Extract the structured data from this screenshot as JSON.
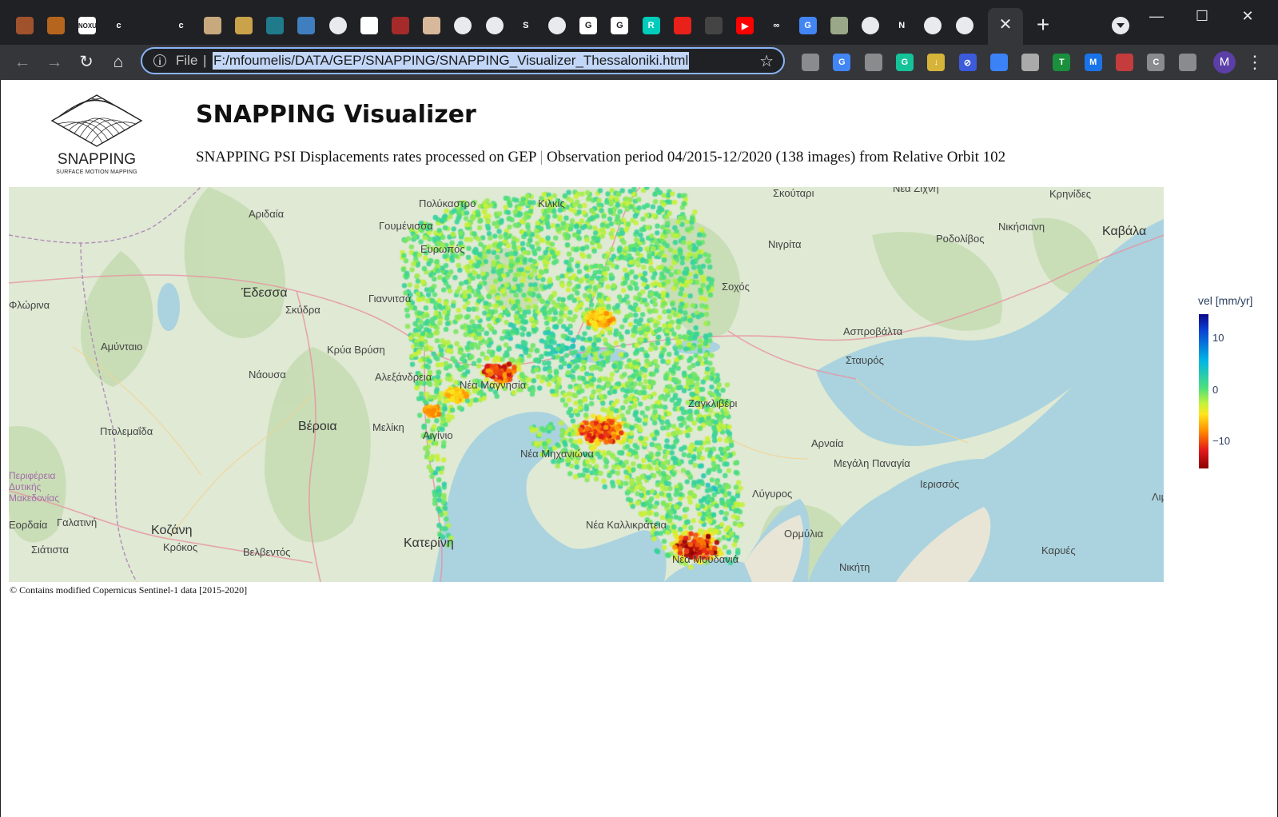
{
  "browser": {
    "tabs": {
      "active_close_glyph": "✕",
      "new_tab_glyph": "+",
      "favicons": [
        {
          "name": "tab-favicon-1",
          "color": "#a0522d",
          "label": ""
        },
        {
          "name": "tab-favicon-2",
          "color": "#b5651d",
          "label": ""
        },
        {
          "name": "tab-favicon-noxu",
          "color": "#ffffff",
          "label": "NOXU"
        },
        {
          "name": "tab-favicon-c1",
          "color": "#202124",
          "label": "c"
        },
        {
          "name": "tab-favicon-c2",
          "color": "#202124",
          "label": "c"
        },
        {
          "name": "tab-favicon-scroll",
          "color": "#c8a97e",
          "label": ""
        },
        {
          "name": "tab-favicon-coin",
          "color": "#c9a24a",
          "label": ""
        },
        {
          "name": "tab-favicon-sdf",
          "color": "#1f7a8c",
          "label": ""
        },
        {
          "name": "tab-favicon-blue",
          "color": "#3f7fbf",
          "label": ""
        },
        {
          "name": "tab-favicon-globe1",
          "color": "#e8eaed",
          "label": ""
        },
        {
          "name": "tab-favicon-bw",
          "color": "#ffffff",
          "label": ""
        },
        {
          "name": "tab-favicon-red",
          "color": "#a52a2a",
          "label": ""
        },
        {
          "name": "tab-favicon-beige",
          "color": "#d8b89a",
          "label": ""
        },
        {
          "name": "tab-favicon-globe2",
          "color": "#e8eaed",
          "label": ""
        },
        {
          "name": "tab-favicon-globe3",
          "color": "#e8eaed",
          "label": ""
        },
        {
          "name": "tab-favicon-s",
          "color": "#202124",
          "label": "S"
        },
        {
          "name": "tab-favicon-chrome1",
          "color": "#e8eaed",
          "label": ""
        },
        {
          "name": "tab-favicon-google1",
          "color": "#ffffff",
          "label": "G"
        },
        {
          "name": "tab-favicon-google2",
          "color": "#ffffff",
          "label": "G"
        },
        {
          "name": "tab-favicon-rg",
          "color": "#00ccbb",
          "label": "R"
        },
        {
          "name": "tab-favicon-redcircle",
          "color": "#e8211b",
          "label": ""
        },
        {
          "name": "tab-favicon-hat",
          "color": "#444",
          "label": ""
        },
        {
          "name": "tab-favicon-youtube",
          "color": "#ff0000",
          "label": "▶"
        },
        {
          "name": "tab-favicon-link",
          "color": "#202124",
          "label": "∞"
        },
        {
          "name": "tab-favicon-translate",
          "color": "#4285f4",
          "label": "G"
        },
        {
          "name": "tab-favicon-photo",
          "color": "#9aa889",
          "label": ""
        },
        {
          "name": "tab-favicon-chrome2",
          "color": "#e8eaed",
          "label": ""
        },
        {
          "name": "tab-favicon-netflix",
          "color": "#202124",
          "label": "N"
        },
        {
          "name": "tab-favicon-chrome3",
          "color": "#e8eaed",
          "label": ""
        },
        {
          "name": "tab-favicon-chrome4",
          "color": "#e8eaed",
          "label": ""
        }
      ]
    },
    "window_controls": {
      "minimize": "—",
      "maximize": "☐",
      "close": "✕"
    },
    "toolbar": {
      "back": "←",
      "forward": "→",
      "reload": "↻",
      "home": "⌂",
      "scheme": "File",
      "separator": "|",
      "url": "F:/mfoumelis/DATA/GEP/SNAPPING/SNAPPING_Visualizer_Thessaloniki.html",
      "star": "☆",
      "profile_initial": "M",
      "menu": "⋮",
      "extensions": [
        {
          "name": "ext-icon-1",
          "color": "#8a8b8d",
          "label": ""
        },
        {
          "name": "ext-google-translate-icon",
          "color": "#4285f4",
          "label": "G"
        },
        {
          "name": "ext-location-icon",
          "color": "#8a8b8d",
          "label": ""
        },
        {
          "name": "ext-grammarly-icon",
          "color": "#15c39a",
          "label": "G"
        },
        {
          "name": "ext-download-icon",
          "color": "#d6b43a",
          "label": "↓"
        },
        {
          "name": "ext-block-icon",
          "color": "#3b5bdb",
          "label": "⊘"
        },
        {
          "name": "ext-mortarboard-icon",
          "color": "#3b82f6",
          "label": ""
        },
        {
          "name": "ext-square-icon",
          "color": "#aaaaaa",
          "label": ""
        },
        {
          "name": "ext-t-icon",
          "color": "#1a8f3c",
          "label": "T"
        },
        {
          "name": "ext-m-icon",
          "color": "#1a73e8",
          "label": "M"
        },
        {
          "name": "ext-printer-icon",
          "color": "#c43c3c",
          "label": ""
        },
        {
          "name": "ext-c-icon",
          "color": "#8a8b8d",
          "label": "C"
        },
        {
          "name": "ext-puzzle-icon",
          "color": "#8a8b8d",
          "label": ""
        }
      ]
    }
  },
  "page": {
    "logo": {
      "name": "SNAPPING",
      "tagline": "SURFACE MOTION MAPPING"
    },
    "title": "SNAPPING Visualizer",
    "subtitle_a": "SNAPPING PSI Displacements rates processed on GEP",
    "subtitle_sep": "|",
    "subtitle_b": "Observation period 04/2015-12/2020 (138 images) from Relative Orbit 102",
    "credit": "© Contains modified Copernicus Sentinel-1 data [2015-2020]"
  },
  "map": {
    "info_glyph": "i",
    "labels": [
      "Αριδαία",
      "Πολύκαστρο",
      "Κιλκίς",
      "Σκούταρι",
      "Νέα Ζίχνη",
      "Κρηνίδες",
      "Γουμένισσα",
      "Ευρωπός",
      "Νιγρίτα",
      "Ροδολίβος",
      "Νικήσιανη",
      "Καβάλα",
      "Έδεσσα",
      "Γιαννιτσά",
      "Σκύδρα",
      "Σοχός",
      "Αμύνταιο",
      "Κρύα Βρύση",
      "Ασπροβάλτα",
      "Νάουσα",
      "Αλεξάνδρεια",
      "Νέα Μαγνησία",
      "Σταυρός",
      "Βέροια",
      "Μελίκη",
      "Αιγίνιο",
      "Ζαγκλιβέρι",
      "Αρναία",
      "Πτολεμαΐδα",
      "Νέα Μηχανιώνα",
      "Μεγάλη Παναγία",
      "Ιερισσός",
      "Περιφέρεια Δυτικής Μακεδονίας",
      "Εορδαία",
      "Γαλατινή",
      "Κοζάνη",
      "Κατερίνη",
      "Νέα Καλλικράτεια",
      "Λύγυρος",
      "Σιάτιστα",
      "Κρόκος",
      "Βελβεντός",
      "Ορμύλια",
      "Καρυές",
      "Νέα Μουδανιά",
      "Νικήτη",
      "Φλώρινα",
      "Λιμένας"
    ],
    "colorbar": {
      "title": "vel [mm/yr]",
      "ticks": [
        "10",
        "0",
        "−10"
      ]
    }
  }
}
